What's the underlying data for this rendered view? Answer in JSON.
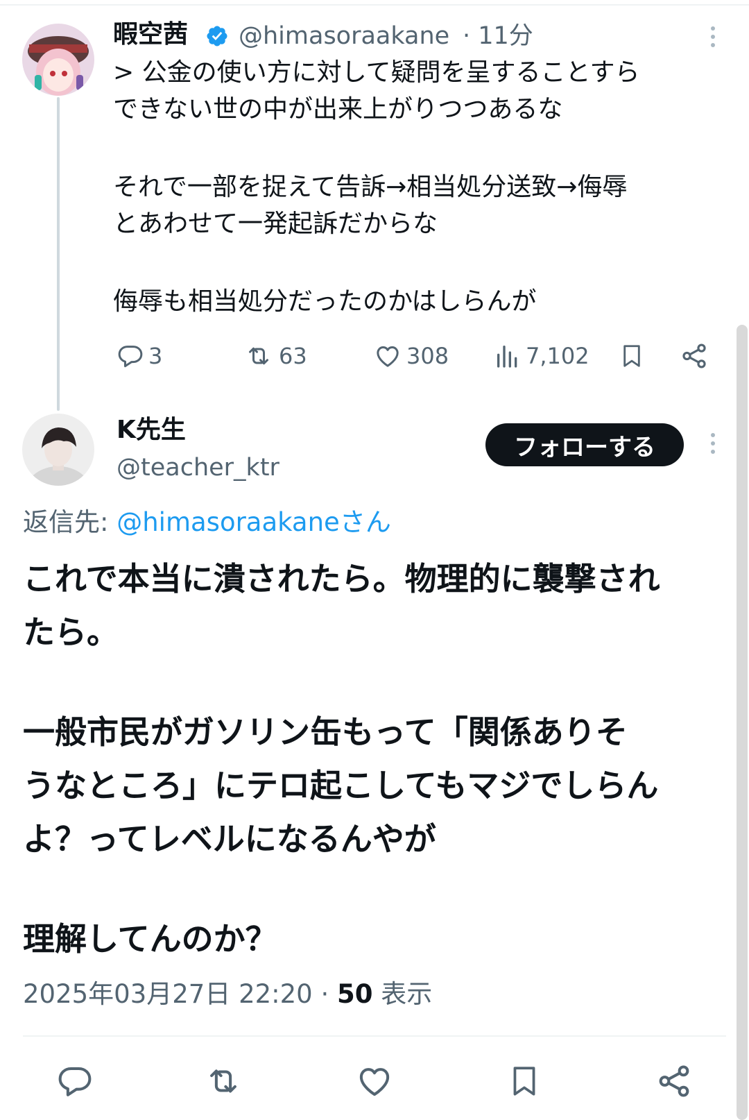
{
  "parent_tweet": {
    "display_name": "暇空茜",
    "handle": "@himasoraakane",
    "time": "· 11分",
    "lines": [
      "> 公金の使い方に対して疑問を呈することすら",
      "できない世の中が出来上がりつつあるな",
      "",
      "それで一部を捉えて告訴→相当処分送致→侮辱",
      "とあわせて一発起訴だからな",
      "",
      "侮辱も相当処分だったのかはしらんが"
    ],
    "stats": {
      "replies": "3",
      "reposts": "63",
      "likes": "308",
      "views": "7,102"
    }
  },
  "reply_tweet": {
    "display_name": "K先生",
    "handle": "@teacher_ktr",
    "follow_label": "フォローする",
    "reply_to_prefix": "返信先: ",
    "reply_to_link": "@himasoraakaneさん",
    "lines": [
      "これで本当に潰されたら。物理的に襲撃され",
      "たら。",
      "",
      "一般市民がガソリン缶もって「関係ありそ",
      "うなところ」にテロ起こしてもマジでしらん",
      "よ？ってレベルになるんやが",
      "",
      "理解してんのか？"
    ],
    "timestamp": "2025年03月27日 22:20",
    "separator": " · ",
    "views": "50",
    "views_label": " 表示"
  },
  "colors": {
    "accent": "#1d9bf0",
    "text": "#0f1419",
    "secondary": "#536471",
    "follow_bg": "#0f1419"
  },
  "icons": [
    "verified-badge-icon",
    "more-icon",
    "reply-icon",
    "repost-icon",
    "like-icon",
    "views-icon",
    "bookmark-icon",
    "share-icon"
  ]
}
